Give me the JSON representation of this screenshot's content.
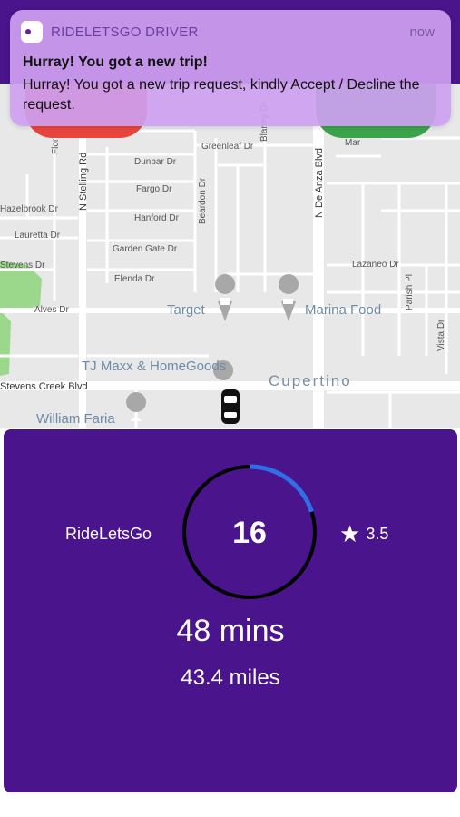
{
  "notification": {
    "app_name": "RIDELETSGO DRIVER",
    "time": "now",
    "title": "Hurray! You got a new trip!",
    "body": "Hurray! You got a new trip request, kindly Accept / Decline the request."
  },
  "map": {
    "streets": [
      "Flor",
      "N Stelling Rd",
      "Dunbar Dr",
      "Fargo Dr",
      "Hanford Dr",
      "Beardon Dr",
      "Greenleaf Dr",
      "Blaney Dr",
      "N De Anza Blvd",
      "Hazelbrook Dr",
      "Lauretta Dr",
      "Garden Gate Dr",
      "Elenda Dr",
      "Stevens Dr",
      "Lazaneo Dr",
      "Parish Pl",
      "Vista Dr",
      "Alves Dr",
      "Stevens Creek Blvd",
      "Mar"
    ],
    "pois": [
      "Target",
      "Marina Food",
      "TJ Maxx & HomeGoods",
      "William Faria"
    ],
    "city": "Cupertino"
  },
  "trip_card": {
    "brand": "RideLetsGo",
    "countdown": "16",
    "countdown_progress": 0.2,
    "rating": "3.5",
    "duration": "48 mins",
    "distance": "43.4 miles"
  },
  "colors": {
    "primary": "#4a148c",
    "accept": "#3ba34a",
    "decline": "#e8453c",
    "ring_progress": "#2f6fe6"
  }
}
